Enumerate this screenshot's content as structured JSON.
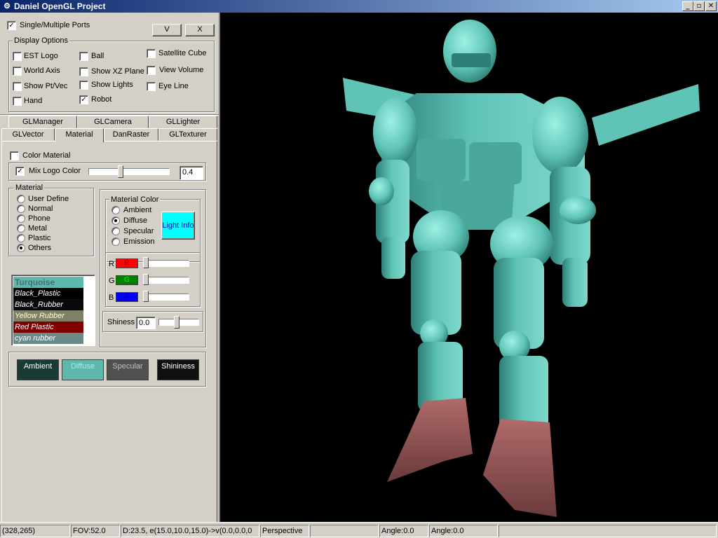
{
  "window": {
    "title": "Daniel OpenGL Project",
    "controls": {
      "minimize": "_",
      "maximize": "▫",
      "close": "✕"
    }
  },
  "top_controls": {
    "ports_checkbox": {
      "label": "Single/Multiple Ports",
      "checked": true,
      "mark": "✓"
    },
    "v_button": "V",
    "x_button": "X"
  },
  "display_options": {
    "title": "Display Options",
    "items": [
      {
        "label": "EST Logo",
        "checked": false,
        "mark": ""
      },
      {
        "label": "Ball",
        "checked": false,
        "mark": ""
      },
      {
        "label": "Satellite Cube",
        "checked": false,
        "mark": ""
      },
      {
        "label": "World Axis",
        "checked": false,
        "mark": ""
      },
      {
        "label": "Show XZ Plane",
        "checked": false,
        "mark": ""
      },
      {
        "label": "View Volume",
        "checked": false,
        "mark": ""
      },
      {
        "label": "Show Pt/Vec",
        "checked": false,
        "mark": ""
      },
      {
        "label": "Show Lights",
        "checked": false,
        "mark": ""
      },
      {
        "label": "Eye Line",
        "checked": false,
        "mark": ""
      },
      {
        "label": "Hand",
        "checked": false,
        "mark": ""
      },
      {
        "label": "Robot",
        "checked": true,
        "mark": "✓"
      }
    ]
  },
  "tabs": {
    "row1": [
      "GLManager",
      "GLCamera",
      "GLLighter"
    ],
    "row2": [
      "GLVector",
      "Material",
      "DanRaster",
      "GLTexturer"
    ],
    "active": "Material"
  },
  "material_tab": {
    "color_material": {
      "label": "Color Material",
      "checked": false,
      "mark": ""
    },
    "mix_logo": {
      "label": "Mix Logo Color",
      "checked": true,
      "mark": "✓",
      "value": "0.4"
    },
    "material_group": {
      "title": "Material",
      "options": [
        "User Define",
        "Normal",
        "Phone",
        "Metal",
        "Plastic",
        "Others"
      ],
      "selected": "Others"
    },
    "material_color_group": {
      "title": "Material Color",
      "options": [
        "Ambient",
        "Diffuse",
        "Specular",
        "Emission"
      ],
      "selected": "Diffuse",
      "light_info_button": "Light Info"
    },
    "rgb": [
      {
        "label": "R",
        "swatch": "R",
        "color": "#ff0000",
        "text_color": "#800000"
      },
      {
        "label": "G",
        "swatch": "G",
        "color": "#008000",
        "text_color": "#00ff00"
      },
      {
        "label": "B",
        "swatch": "B",
        "color": "#0000ff",
        "text_color": "#000080"
      }
    ],
    "shininess": {
      "label": "Shiness",
      "value": "0.0"
    },
    "material_list": [
      {
        "name": "Turquoise",
        "bg": "#5fb8ae",
        "fg": "#4a6e6a",
        "selected": true
      },
      {
        "name": "Black_Plastic",
        "bg": "#000000",
        "fg": "#ffffff"
      },
      {
        "name": "Black_Rubber",
        "bg": "#0a0a0a",
        "fg": "#ffffff"
      },
      {
        "name": "Yellow Rubber",
        "bg": "#808068",
        "fg": "#ffffd0"
      },
      {
        "name": "Red Plastic",
        "bg": "#800000",
        "fg": "#ffffff"
      },
      {
        "name": "cyan rubber",
        "bg": "#6a8a88",
        "fg": "#ffffff"
      }
    ],
    "color_buttons": [
      {
        "label": "Ambient",
        "bg": "#1a3a36",
        "fg": "#ffffff"
      },
      {
        "label": "Diffuse",
        "bg": "#5fb8ae",
        "fg": "#a8ece4"
      },
      {
        "label": "Specular",
        "bg": "#505050",
        "fg": "#c0c0c0"
      },
      {
        "label": "Shininess",
        "bg": "#101010",
        "fg": "#ffffff"
      }
    ]
  },
  "statusbar": {
    "cells": [
      "(328,265)",
      "FOV:52.0",
      "D:23.5, e(15.0,10.0,15.0)->v(0.0,0.0,0",
      "Perspective",
      "",
      "Angle:0.0",
      "Angle:0.0",
      ""
    ]
  },
  "colors": {
    "robot_body": "#5fc4b6",
    "robot_shadow": "#2e7f76",
    "robot_feet": "#b06a6a",
    "viewport_bg": "#000000",
    "light_info_bg": "#00ffff"
  }
}
